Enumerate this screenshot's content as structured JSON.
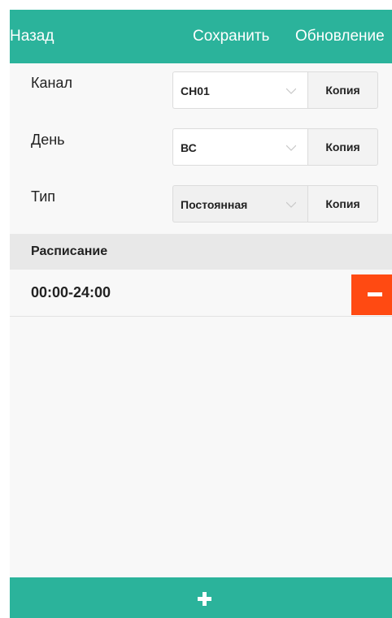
{
  "topbar": {
    "back_label": "Назад",
    "save_label": "Сохранить",
    "refresh_label": "Обновление"
  },
  "settings": {
    "channel": {
      "label": "Канал",
      "value": "CH01",
      "copy_label": "Копия"
    },
    "day": {
      "label": "День",
      "value": "ВС",
      "copy_label": "Копия"
    },
    "type": {
      "label": "Тип",
      "value": "Постоянная",
      "copy_label": "Копия"
    }
  },
  "schedule": {
    "header": "Расписание",
    "items": [
      {
        "time": "00:00-24:00"
      }
    ]
  },
  "icons": {
    "select_arrow": "chevron-down-icon",
    "delete": "minus-icon",
    "add": "plus-icon"
  },
  "colors": {
    "accent": "#2bb39b",
    "delete": "#ff4a12"
  }
}
